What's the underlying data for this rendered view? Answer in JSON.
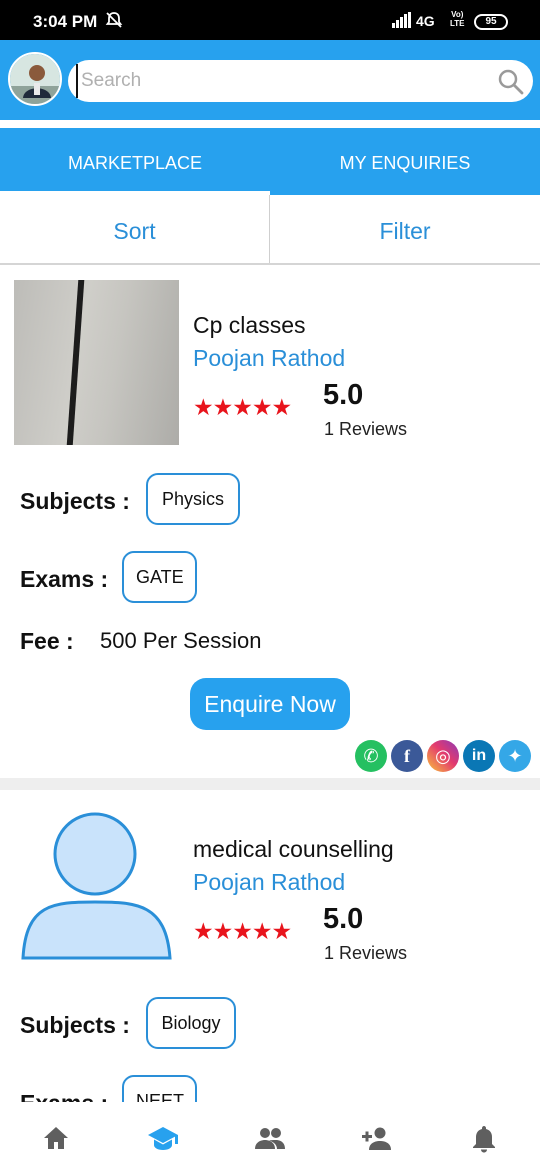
{
  "status_bar": {
    "time": "3:04 PM",
    "network": "4G",
    "volte_top": "Vo)",
    "volte_bottom": "LTE",
    "battery": "95"
  },
  "header": {
    "search_placeholder": "Search",
    "accent_color": "#27a1ee"
  },
  "tabs": [
    {
      "label": "MARKETPLACE",
      "active": true
    },
    {
      "label": "MY ENQUIRIES",
      "active": false
    }
  ],
  "toolbar": {
    "sort_label": "Sort",
    "filter_label": "Filter"
  },
  "listings": [
    {
      "title": "Cp classes",
      "owner": "Poojan Rathod",
      "stars": "★★★★★",
      "rating": "5.0",
      "reviews": "1 Reviews",
      "subjects_label": "Subjects :",
      "subject": "Physics",
      "exams_label": "Exams :",
      "exam": "GATE",
      "fee_label": "Fee :",
      "fee": "500 Per Session",
      "enquire_label": "Enquire Now",
      "social": [
        {
          "name": "whatsapp-icon",
          "glyph": "✆"
        },
        {
          "name": "facebook-icon",
          "glyph": "f"
        },
        {
          "name": "instagram-icon",
          "glyph": "◎"
        },
        {
          "name": "linkedin-icon",
          "glyph": "in"
        },
        {
          "name": "twitter-icon",
          "glyph": "✦"
        }
      ]
    },
    {
      "title": "medical counselling",
      "owner": "Poojan Rathod",
      "stars": "★★★★★",
      "rating": "5.0",
      "reviews": "1 Reviews",
      "subjects_label": "Subjects :",
      "subject": "Biology",
      "exams_label": "Exams :",
      "exam": "NEET"
    }
  ],
  "bottom_nav": [
    {
      "name": "home-icon",
      "active": false
    },
    {
      "name": "school-icon",
      "active": true
    },
    {
      "name": "people-icon",
      "active": false
    },
    {
      "name": "add-person-icon",
      "active": false
    },
    {
      "name": "notification-bell-icon",
      "active": false
    }
  ]
}
